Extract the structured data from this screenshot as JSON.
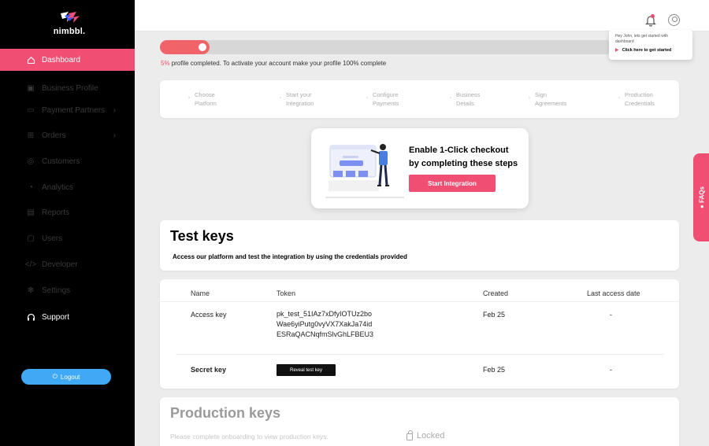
{
  "brand": {
    "name": "nimbbl."
  },
  "sidebar": {
    "items": [
      {
        "label": "Dashboard",
        "icon": "home-icon"
      },
      {
        "label": "Business Profile",
        "icon": "briefcase-icon"
      },
      {
        "label": "Payment Partners",
        "icon": "card-icon"
      },
      {
        "label": "Orders",
        "icon": "cart-icon"
      },
      {
        "label": "Customers",
        "icon": "users-icon"
      },
      {
        "label": "Analytics",
        "icon": "chart-icon"
      },
      {
        "label": "Reports",
        "icon": "report-icon"
      },
      {
        "label": "Users",
        "icon": "user-icon"
      },
      {
        "label": "Developer",
        "icon": "code-icon"
      },
      {
        "label": "Settings",
        "icon": "gear-icon"
      },
      {
        "label": "Support",
        "icon": "headset-icon"
      }
    ],
    "logout_label": "Logout"
  },
  "tooltip": {
    "message": "Hey John, lets get started with dashboard",
    "cta": "Click here to get started"
  },
  "progress": {
    "percent": 5,
    "pct_label": "5%",
    "text": " profile completed. To activate your account make your profile 100% complete"
  },
  "steps": [
    {
      "l1": "Choose",
      "l2": "Platform"
    },
    {
      "l1": "Start your",
      "l2": "Integration"
    },
    {
      "l1": "Configure",
      "l2": "Payments"
    },
    {
      "l1": "Business",
      "l2": "Details"
    },
    {
      "l1": "Sign",
      "l2": "Agreements"
    },
    {
      "l1": "Production",
      "l2": "Credentials"
    }
  ],
  "promo": {
    "title_l1": "Enable 1-Click checkout",
    "title_l2": "by completing these steps",
    "button": "Start Integration"
  },
  "test_keys": {
    "title": "Test keys",
    "subtitle": "Access our platform and test the integration by using the credentials provided",
    "columns": [
      "Name",
      "Token",
      "Created",
      "Last access date"
    ],
    "rows": [
      {
        "name": "Access key",
        "token_l1": "pk_test_51IAz7xDfyIOTUz2bo",
        "token_l2": "Wae6yiPutg0vyVX7XakJa74id",
        "token_l3": "ESRaQACNqfmSlvGhLFBEU3",
        "created": "Feb 25",
        "last_access": "-"
      },
      {
        "name": "Secret key",
        "reveal_label": "Reveal test key",
        "created": "Feb 25",
        "last_access": "-"
      }
    ]
  },
  "production_keys": {
    "title": "Production keys",
    "subtitle": "Please complete onboarding to view production keys.",
    "locked_label": "Locked"
  },
  "faq": {
    "label": "FAQs"
  },
  "colors": {
    "accent": "#f04f73",
    "progress": "#f06368",
    "logout": "#3fa9f5"
  }
}
